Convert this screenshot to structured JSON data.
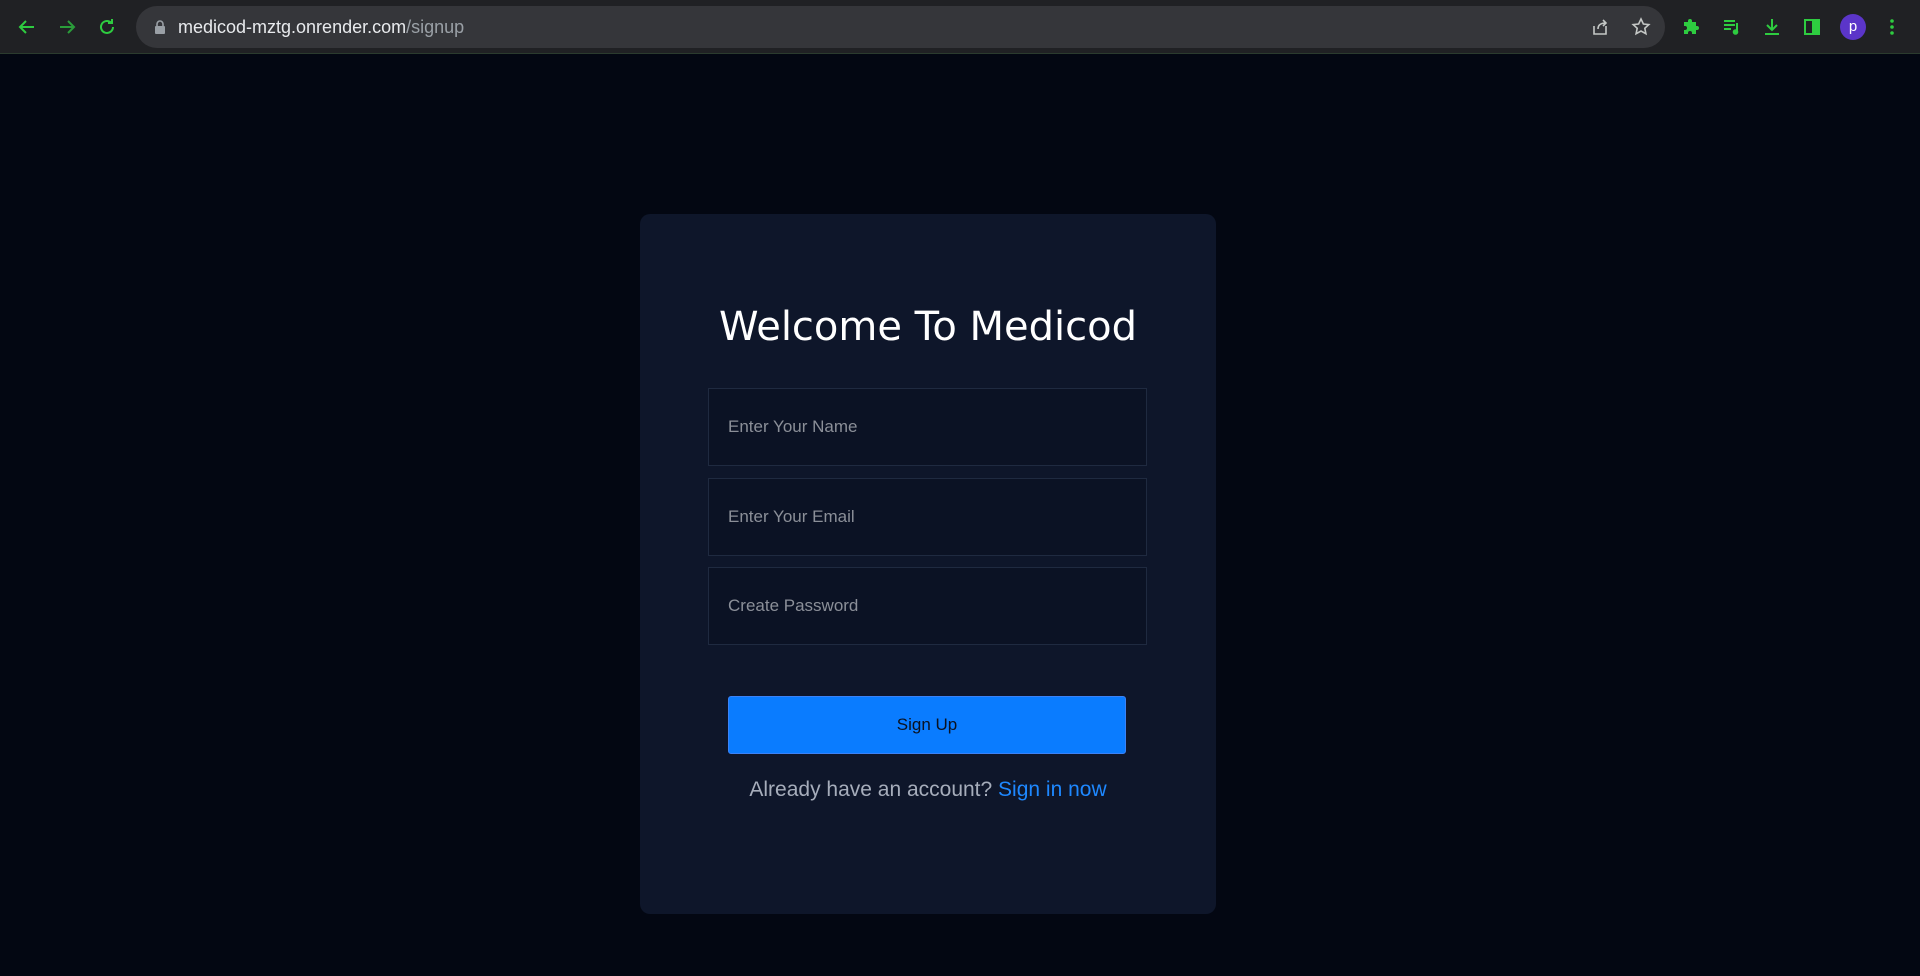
{
  "browser": {
    "url_host": "medicod-mztg.onrender.com",
    "url_path": "/signup",
    "avatar_letter": "p",
    "icons": [
      "back-icon",
      "forward-icon",
      "reload-icon",
      "lock-icon",
      "share-icon",
      "star-icon",
      "puzzle-icon",
      "media-icon",
      "download-icon",
      "sidepanel-icon",
      "kebab-menu-icon"
    ]
  },
  "signup": {
    "title": "Welcome To Medicod",
    "name_placeholder": "Enter Your Name",
    "email_placeholder": "Enter Your Email",
    "password_placeholder": "Create Password",
    "submit_label": "Sign Up",
    "account_prompt": "Already have an account?",
    "signin_link": "Sign in now"
  },
  "colors": {
    "page_bg": "#030712",
    "card_bg": "#0e162a",
    "accent": "#0a7cff",
    "browser_icon": "#2ecc40"
  }
}
